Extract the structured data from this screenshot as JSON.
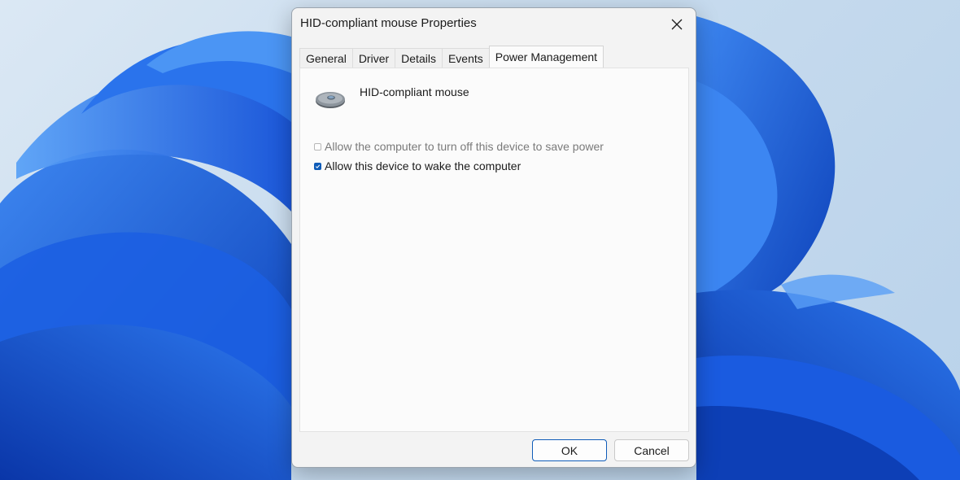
{
  "dialog": {
    "title": "HID-compliant mouse Properties",
    "close_icon": "close-icon"
  },
  "tabs": [
    {
      "label": "General",
      "active": false
    },
    {
      "label": "Driver",
      "active": false
    },
    {
      "label": "Details",
      "active": false
    },
    {
      "label": "Events",
      "active": false
    },
    {
      "label": "Power Management",
      "active": true
    }
  ],
  "device": {
    "icon": "mouse-icon",
    "name": "HID-compliant mouse"
  },
  "options": [
    {
      "label": "Allow the computer to turn off this device to save power",
      "checked": false,
      "enabled": false
    },
    {
      "label": "Allow this device to wake the computer",
      "checked": true,
      "enabled": true
    }
  ],
  "buttons": {
    "ok": "OK",
    "cancel": "Cancel"
  },
  "colors": {
    "accent": "#0f5cb8",
    "wallpaper_blue": "#1a5fe0"
  }
}
